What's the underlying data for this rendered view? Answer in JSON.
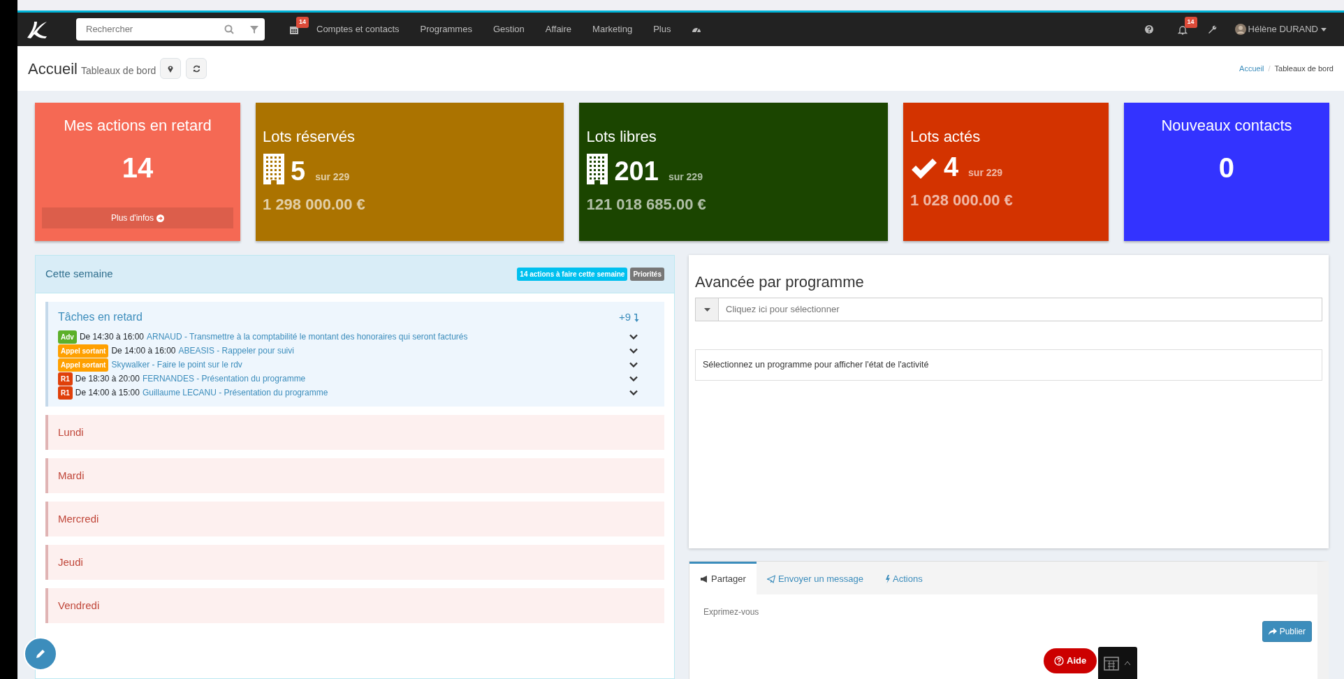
{
  "navbar": {
    "search": {
      "placeholder": "Rechercher"
    },
    "calendar_badge": "14",
    "menu": [
      "Comptes et contacts",
      "Programmes",
      "Gestion",
      "Affaire",
      "Marketing",
      "Plus"
    ],
    "notification_badge": "14",
    "user": "Hélène DURAND"
  },
  "header": {
    "title": "Accueil",
    "subtitle": "Tableaux de bord",
    "breadcrumb_separator": "/",
    "breadcrumb": [
      {
        "label": "Accueil",
        "selected": false
      },
      {
        "label": "Tableaux de bord",
        "selected": true
      }
    ]
  },
  "tiles": [
    {
      "kind": "counter",
      "title": "Mes actions en retard",
      "value": "14",
      "link": "Plus d'infos",
      "color": "#f56954"
    },
    {
      "kind": "building",
      "title": "Lots réservés",
      "value": "5",
      "total": "sur 229",
      "amount": "1 298 000.00 €",
      "color": "#ab7300"
    },
    {
      "kind": "building",
      "title": "Lots libres",
      "value": "201",
      "total": "sur 229",
      "amount": "121 018 685.00 €",
      "color": "#1b4500"
    },
    {
      "kind": "check",
      "title": "Lots actés",
      "value": "4",
      "total": "sur 229",
      "amount": "1 028 000.00 €",
      "color": "#d33300"
    },
    {
      "kind": "counter",
      "title": "Nouveaux contacts",
      "value": "0",
      "color": "#3333ff"
    }
  ],
  "week": {
    "title": "Cette semaine",
    "badges": [
      {
        "text": "14 actions à faire cette semaine",
        "color": "#00c0ef"
      },
      {
        "text": "Priorités",
        "color": "#777777"
      }
    ],
    "overdue": {
      "title": "Tâches en retard",
      "more": "+9",
      "items": [
        {
          "tag": "Adv",
          "color": "#5cb02a",
          "time": "De 14:30 à 16:00",
          "text": "ARNAUD - Transmettre à la comptabilité le montant des honoraires qui seront facturés"
        },
        {
          "tag": "Appel sortant",
          "color": "#ffa000",
          "time": "De 14:00 à 16:00",
          "text": "ABEASIS - Rappeler pour suivi"
        },
        {
          "tag": "Appel sortant",
          "color": "#ffa000",
          "text": "Skywalker - Faire le point sur le rdv"
        },
        {
          "tag": "R1",
          "color": "#e0400a",
          "time": "De 18:30 à 20:00",
          "text": "FERNANDES - Présentation du programme"
        },
        {
          "tag": "R1",
          "color": "#e0400a",
          "time": "De 14:00 à 15:00",
          "text": "Guillaume LECANU - Présentation du programme"
        }
      ]
    },
    "days": [
      "Lundi",
      "Mardi",
      "Mercredi",
      "Jeudi",
      "Vendredi"
    ]
  },
  "progress": {
    "title": "Avancée par programme",
    "select": {
      "placeholder": "Cliquez ici pour sélectionner"
    },
    "message": "Sélectionnez un programme pour afficher l'état de l'activité"
  },
  "feed": {
    "tabs": [
      {
        "label": "Partager",
        "selected": true
      },
      {
        "label": "Envoyer un message",
        "selected": false
      },
      {
        "label": "Actions",
        "selected": false
      }
    ],
    "placeholder": "Exprimez-vous",
    "button": "Publier"
  },
  "help_button": "Aide"
}
